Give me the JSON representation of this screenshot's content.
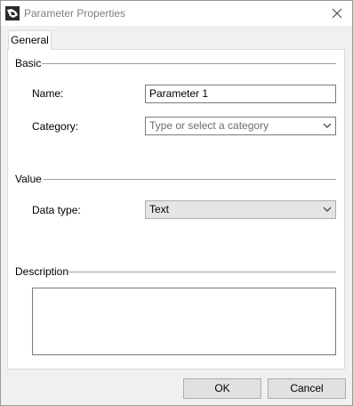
{
  "window": {
    "title": "Parameter Properties"
  },
  "tabs": [
    {
      "label": "General"
    }
  ],
  "basic": {
    "group_label": "Basic",
    "name_label": "Name:",
    "name_value": "Parameter 1",
    "category_label": "Category:",
    "category_placeholder": "Type or select a category"
  },
  "value": {
    "group_label": "Value",
    "data_type_label": "Data type:",
    "data_type_selected": "Text"
  },
  "description": {
    "group_label": "Description",
    "text": ""
  },
  "buttons": {
    "ok": "OK",
    "cancel": "Cancel"
  },
  "icons": {
    "app": "app-icon",
    "close": "close-icon",
    "dropdown": "chevron-down-icon"
  }
}
